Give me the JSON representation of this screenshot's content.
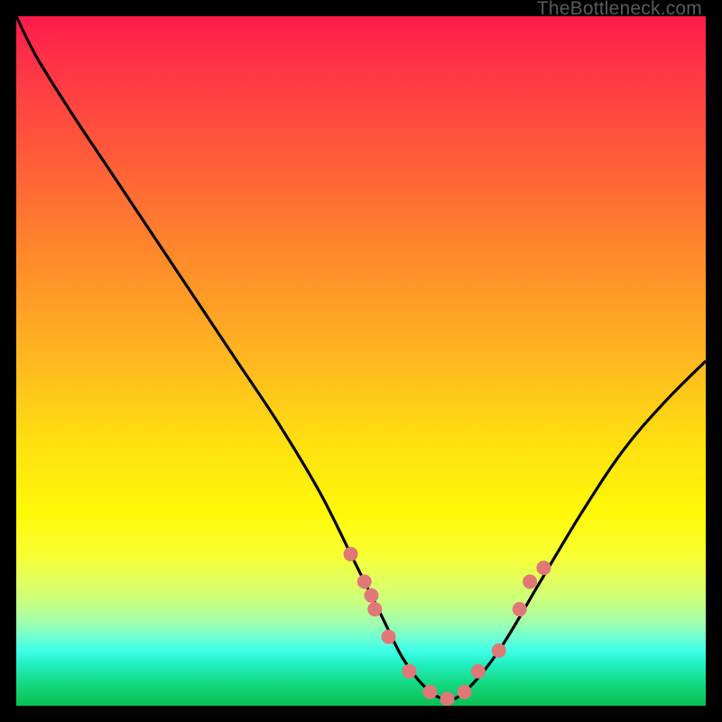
{
  "attribution": "TheBottleneck.com",
  "chart_data": {
    "type": "line",
    "title": "",
    "xlabel": "",
    "ylabel": "",
    "xlim": [
      0,
      100
    ],
    "ylim": [
      0,
      100
    ],
    "curve": {
      "x": [
        0,
        3,
        8,
        14,
        20,
        26,
        32,
        38,
        44,
        49,
        53,
        56,
        59,
        62,
        65,
        70,
        76,
        82,
        88,
        94,
        100
      ],
      "y": [
        100,
        94,
        86,
        77,
        68,
        59,
        50,
        41,
        31,
        21,
        13,
        7,
        3,
        1,
        2,
        8,
        18,
        28,
        37,
        44,
        50
      ]
    },
    "markers": {
      "x": [
        48.5,
        50.5,
        51.5,
        52,
        54,
        57,
        60,
        62.5,
        65,
        67,
        70,
        73,
        74.5,
        76.5
      ],
      "y": [
        22,
        18,
        16,
        14,
        10,
        5,
        2,
        1,
        2,
        5,
        8,
        14,
        18,
        20
      ],
      "color": "#e07878",
      "radius": 8
    },
    "gradient_colors": {
      "top": "#ff1a4a",
      "mid": "#ffe010",
      "bottom": "#08c050"
    }
  }
}
